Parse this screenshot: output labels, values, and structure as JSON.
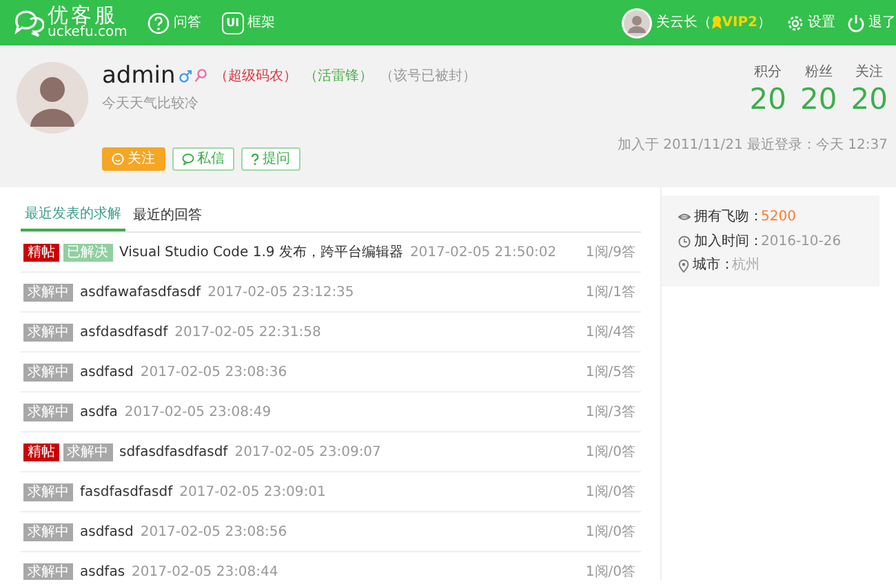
{
  "header": {
    "logo_title": "优客服",
    "logo_domain": "uckefu.com",
    "nav": [
      {
        "kind": "question",
        "label": "问答"
      },
      {
        "kind": "ui",
        "icon_text": "UI",
        "label": "框架"
      }
    ],
    "user": {
      "name": "关云长（",
      "vip": "VIP2",
      "name_end": "）"
    },
    "settings": "设置",
    "logout": "退了"
  },
  "profile": {
    "username": "admin",
    "tags": [
      {
        "text": "（超级码农）",
        "color": "#d9363e"
      },
      {
        "text": "（活雷锋）",
        "color": "#4cae4c"
      },
      {
        "text": "（该号已被封）",
        "color": "#999999"
      }
    ],
    "signature": "今天天气比较冷",
    "buttons": [
      {
        "kind": "follow",
        "label": "关注"
      },
      {
        "kind": "message",
        "label": "私信"
      },
      {
        "kind": "ask",
        "label": "提问"
      }
    ],
    "stats": [
      {
        "label": "积分",
        "value": "20"
      },
      {
        "label": "粉丝",
        "value": "20"
      },
      {
        "label": "关注",
        "value": "20"
      }
    ],
    "joined": "加入于 2011/11/21 最近登录：今天 12:37"
  },
  "tabs": [
    {
      "label": "最近发表的求解",
      "selected": true
    },
    {
      "label": "最近的回答",
      "selected": false
    }
  ],
  "questions": [
    {
      "tags": [
        {
          "kind": "featured",
          "text": "精帖"
        },
        {
          "kind": "solved",
          "text": "已解决"
        }
      ],
      "title": "Visual Studio Code 1.9 发布，跨平台编辑器",
      "time": "2017-02-05 21:50:02",
      "stats": "1阅/9答"
    },
    {
      "tags": [
        {
          "kind": "pending",
          "text": "求解中"
        }
      ],
      "title": "asdfawafasdfasdf",
      "time": "2017-02-05 23:12:35",
      "stats": "1阅/1答"
    },
    {
      "tags": [
        {
          "kind": "pending",
          "text": "求解中"
        }
      ],
      "title": "asfdasdfasdf",
      "time": "2017-02-05 22:31:58",
      "stats": "1阅/4答"
    },
    {
      "tags": [
        {
          "kind": "pending",
          "text": "求解中"
        }
      ],
      "title": "asdfasd",
      "time": "2017-02-05 23:08:36",
      "stats": "1阅/5答"
    },
    {
      "tags": [
        {
          "kind": "pending",
          "text": "求解中"
        }
      ],
      "title": "asdfa",
      "time": "2017-02-05 23:08:49",
      "stats": "1阅/3答"
    },
    {
      "tags": [
        {
          "kind": "featured",
          "text": "精帖"
        },
        {
          "kind": "pending",
          "text": "求解中"
        }
      ],
      "title": "sdfasdfasdfasdf",
      "time": "2017-02-05 23:09:07",
      "stats": "1阅/0答"
    },
    {
      "tags": [
        {
          "kind": "pending",
          "text": "求解中"
        }
      ],
      "title": "fasdfasdfasdf",
      "time": "2017-02-05 23:09:01",
      "stats": "1阅/0答"
    },
    {
      "tags": [
        {
          "kind": "pending",
          "text": "求解中"
        }
      ],
      "title": "asdfasd",
      "time": "2017-02-05 23:08:56",
      "stats": "1阅/0答"
    },
    {
      "tags": [
        {
          "kind": "pending",
          "text": "求解中"
        }
      ],
      "title": "asdfas",
      "time": "2017-02-05 23:08:44",
      "stats": "1阅/0答"
    }
  ],
  "info": [
    {
      "kind": "kiss",
      "label": "拥有飞吻：",
      "value": "5200",
      "color": "#ff7a2f"
    },
    {
      "kind": "clock",
      "label": "加入时间：",
      "value": "2016-10-26",
      "color": "#999999"
    },
    {
      "kind": "pin",
      "label": "城市：",
      "value": "杭州",
      "color": "#aaaaaa"
    }
  ]
}
